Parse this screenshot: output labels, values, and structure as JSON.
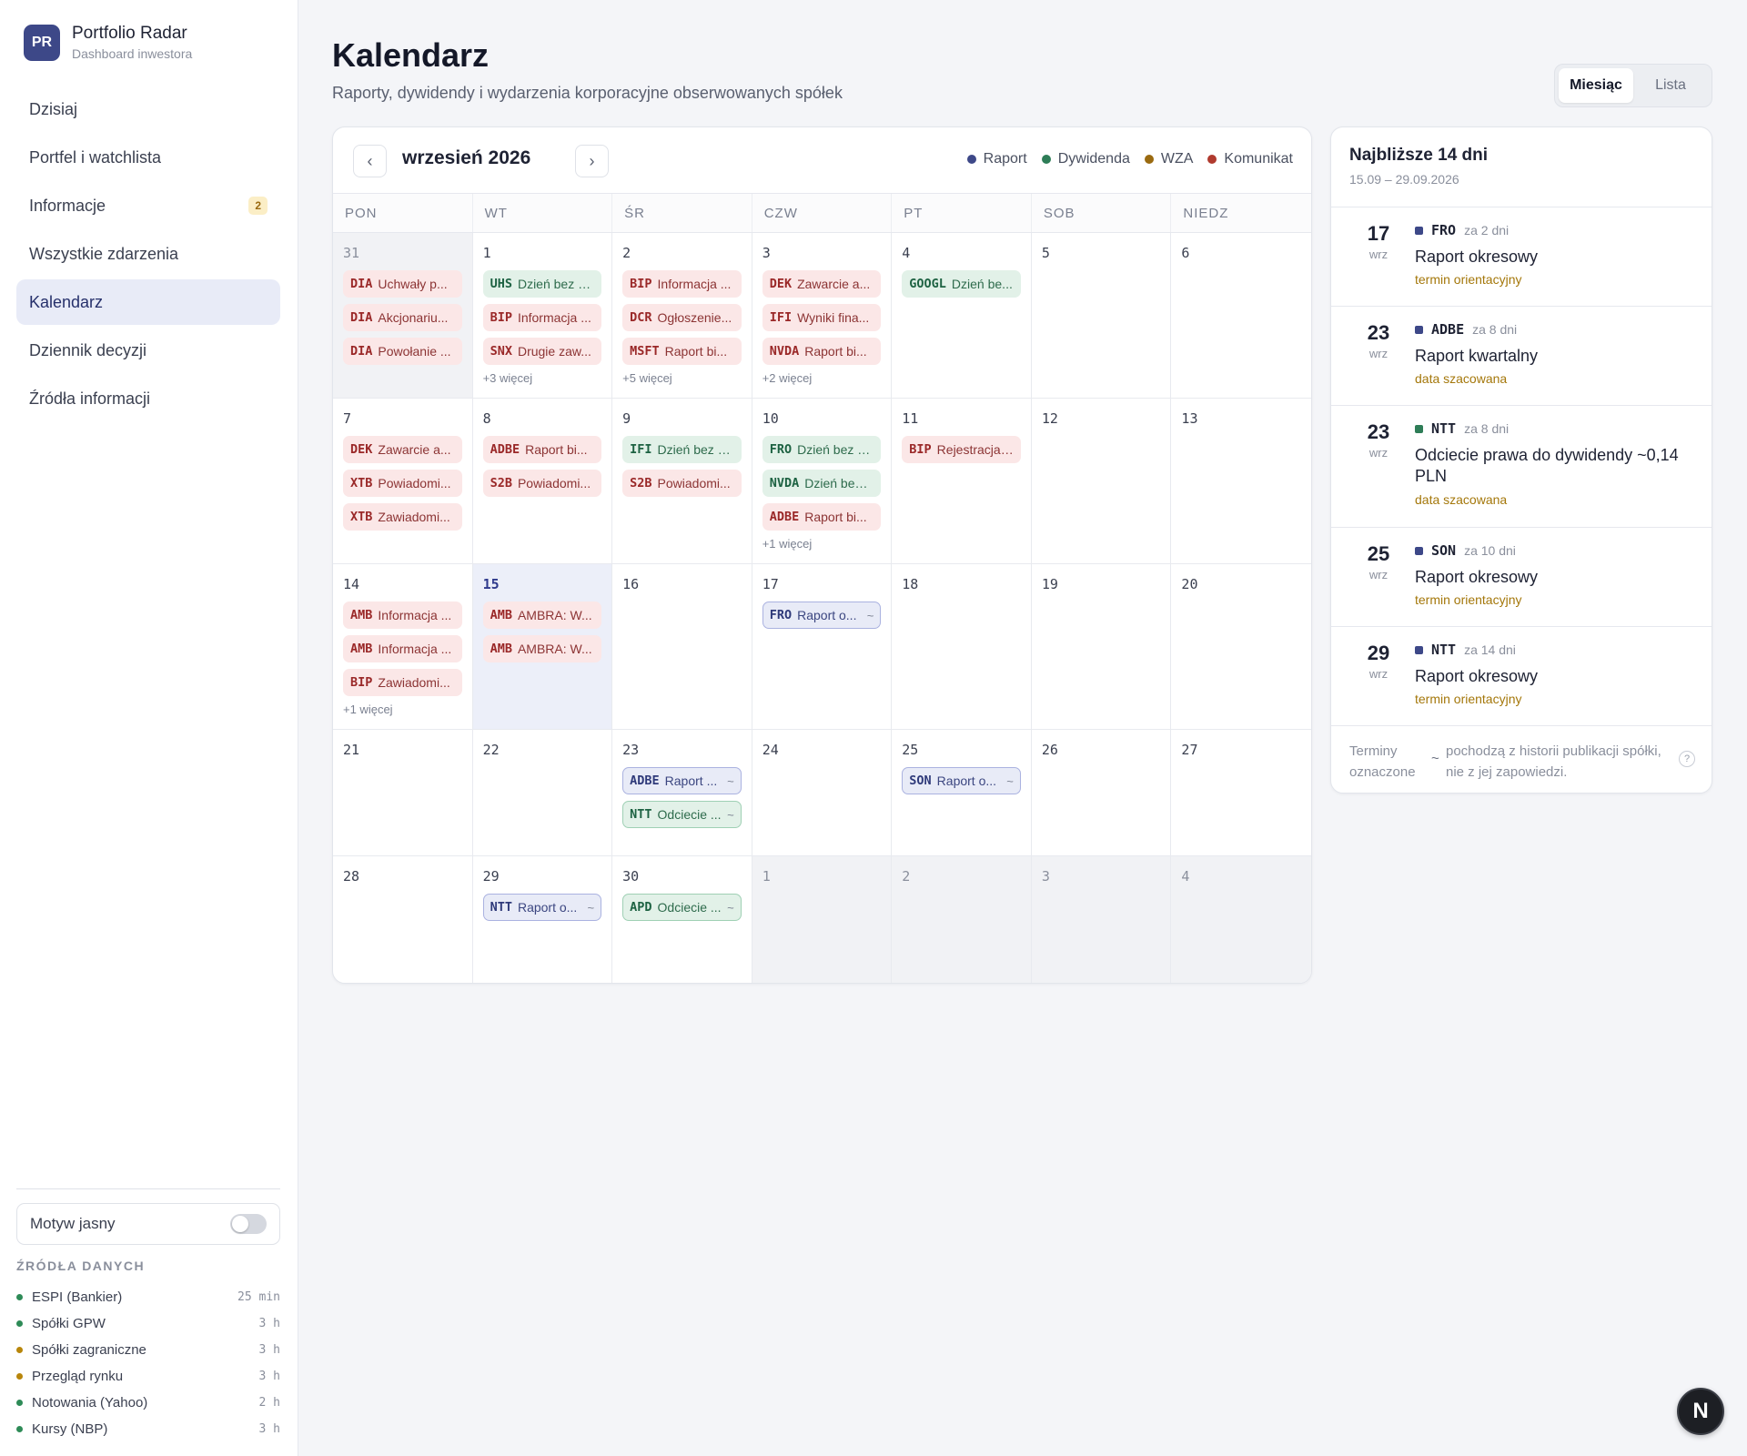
{
  "brand": {
    "logo": "PR",
    "name": "Portfolio Radar",
    "subtitle": "Dashboard inwestora"
  },
  "nav": [
    {
      "label": "Dzisiaj",
      "badge": ""
    },
    {
      "label": "Portfel i watchlista",
      "badge": ""
    },
    {
      "label": "Informacje",
      "badge": "2"
    },
    {
      "label": "Wszystkie zdarzenia",
      "badge": ""
    },
    {
      "label": "Kalendarz",
      "badge": "",
      "active": true
    },
    {
      "label": "Dziennik decyzji",
      "badge": ""
    },
    {
      "label": "Źródła informacji",
      "badge": ""
    }
  ],
  "theme_toggle": {
    "label": "Motyw jasny",
    "on": false
  },
  "sources": {
    "title": "ŹRÓDŁA DANYCH",
    "items": [
      {
        "name": "ESPI (Bankier)",
        "age": "25 min",
        "color": "#2e8b57"
      },
      {
        "name": "Spółki GPW",
        "age": "3 h",
        "color": "#2e8b57"
      },
      {
        "name": "Spółki zagraniczne",
        "age": "3 h",
        "color": "#b8860b"
      },
      {
        "name": "Przegląd rynku",
        "age": "3 h",
        "color": "#b8860b"
      },
      {
        "name": "Notowania (Yahoo)",
        "age": "2 h",
        "color": "#2e8b57"
      },
      {
        "name": "Kursy (NBP)",
        "age": "3 h",
        "color": "#2e8b57"
      }
    ]
  },
  "header": {
    "title": "Kalendarz",
    "subtitle": "Raporty, dywidendy i wydarzenia korporacyjne obserwowanych spółek"
  },
  "view_switch": {
    "month": "Miesiąc",
    "list": "Lista"
  },
  "calendar": {
    "prev": "‹",
    "next": "›",
    "month_label": "wrzesień 2026",
    "legend": [
      {
        "label": "Raport",
        "color": "#3d4888"
      },
      {
        "label": "Dywidenda",
        "color": "#2e7d57"
      },
      {
        "label": "WZA",
        "color": "#9a6a10"
      },
      {
        "label": "Komunikat",
        "color": "#b03a2e"
      }
    ],
    "weekdays": [
      "PON",
      "WT",
      "ŚR",
      "CZW",
      "PT",
      "SOB",
      "NIEDZ"
    ],
    "days": [
      {
        "num": "31",
        "other": true,
        "events": [
          {
            "ticker": "DIA",
            "title": "Uchwały p...",
            "type": "komunikat"
          },
          {
            "ticker": "DIA",
            "title": "Akcjonariu...",
            "type": "komunikat"
          },
          {
            "ticker": "DIA",
            "title": "Powołanie ...",
            "type": "komunikat"
          }
        ],
        "more": ""
      },
      {
        "num": "1",
        "events": [
          {
            "ticker": "UHS",
            "title": "Dzień bez d...",
            "type": "dywidenda"
          },
          {
            "ticker": "BIP",
            "title": "Informacja ...",
            "type": "komunikat"
          },
          {
            "ticker": "SNX",
            "title": "Drugie zaw...",
            "type": "komunikat"
          }
        ],
        "more": "+3 więcej"
      },
      {
        "num": "2",
        "events": [
          {
            "ticker": "BIP",
            "title": "Informacja ...",
            "type": "komunikat"
          },
          {
            "ticker": "DCR",
            "title": "Ogłoszenie...",
            "type": "komunikat"
          },
          {
            "ticker": "MSFT",
            "title": "Raport bi...",
            "type": "komunikat"
          }
        ],
        "more": "+5 więcej"
      },
      {
        "num": "3",
        "events": [
          {
            "ticker": "DEK",
            "title": "Zawarcie a...",
            "type": "komunikat"
          },
          {
            "ticker": "IFI",
            "title": "Wyniki fina...",
            "type": "komunikat"
          },
          {
            "ticker": "NVDA",
            "title": "Raport bi...",
            "type": "komunikat"
          }
        ],
        "more": "+2 więcej"
      },
      {
        "num": "4",
        "events": [
          {
            "ticker": "GOOGL",
            "title": "Dzień be...",
            "type": "dywidenda"
          }
        ],
        "more": ""
      },
      {
        "num": "5",
        "events": [],
        "more": ""
      },
      {
        "num": "6",
        "events": [],
        "more": ""
      },
      {
        "num": "7",
        "events": [
          {
            "ticker": "DEK",
            "title": "Zawarcie a...",
            "type": "komunikat"
          },
          {
            "ticker": "XTB",
            "title": "Powiadomi...",
            "type": "komunikat"
          },
          {
            "ticker": "XTB",
            "title": "Zawiadomi...",
            "type": "komunikat"
          }
        ],
        "more": ""
      },
      {
        "num": "8",
        "events": [
          {
            "ticker": "ADBE",
            "title": "Raport bi...",
            "type": "komunikat"
          },
          {
            "ticker": "S2B",
            "title": "Powiadomi...",
            "type": "komunikat"
          }
        ],
        "more": ""
      },
      {
        "num": "9",
        "events": [
          {
            "ticker": "IFI",
            "title": "Dzień bez d...",
            "type": "dywidenda"
          },
          {
            "ticker": "S2B",
            "title": "Powiadomi...",
            "type": "komunikat"
          }
        ],
        "more": ""
      },
      {
        "num": "10",
        "events": [
          {
            "ticker": "FRO",
            "title": "Dzień bez d...",
            "type": "dywidenda"
          },
          {
            "ticker": "NVDA",
            "title": "Dzień bez ...",
            "type": "dywidenda"
          },
          {
            "ticker": "ADBE",
            "title": "Raport bi...",
            "type": "komunikat"
          }
        ],
        "more": "+1 więcej"
      },
      {
        "num": "11",
        "events": [
          {
            "ticker": "BIP",
            "title": "Rejestracja ...",
            "type": "komunikat"
          }
        ],
        "more": ""
      },
      {
        "num": "12",
        "events": [],
        "more": ""
      },
      {
        "num": "13",
        "events": [],
        "more": ""
      },
      {
        "num": "14",
        "events": [
          {
            "ticker": "AMB",
            "title": "Informacja ...",
            "type": "komunikat"
          },
          {
            "ticker": "AMB",
            "title": "Informacja ...",
            "type": "komunikat"
          },
          {
            "ticker": "BIP",
            "title": "Zawiadomi...",
            "type": "komunikat"
          }
        ],
        "more": "+1 więcej"
      },
      {
        "num": "15",
        "today": true,
        "events": [
          {
            "ticker": "AMB",
            "title": "AMBRA: W...",
            "type": "komunikat"
          },
          {
            "ticker": "AMB",
            "title": "AMBRA: W...",
            "type": "komunikat"
          }
        ],
        "more": ""
      },
      {
        "num": "16",
        "events": [],
        "more": ""
      },
      {
        "num": "17",
        "events": [
          {
            "ticker": "FRO",
            "title": "Raport o...",
            "type": "raport",
            "tilde": "~"
          }
        ],
        "more": ""
      },
      {
        "num": "18",
        "events": [],
        "more": ""
      },
      {
        "num": "19",
        "events": [],
        "more": ""
      },
      {
        "num": "20",
        "events": [],
        "more": ""
      },
      {
        "num": "21",
        "events": [],
        "more": ""
      },
      {
        "num": "22",
        "events": [],
        "more": ""
      },
      {
        "num": "23",
        "events": [
          {
            "ticker": "ADBE",
            "title": "Raport ...",
            "type": "raport",
            "tilde": "~"
          },
          {
            "ticker": "NTT",
            "title": "Odciecie ...",
            "type": "dywidenda est",
            "tilde": "~"
          }
        ],
        "more": ""
      },
      {
        "num": "24",
        "events": [],
        "more": ""
      },
      {
        "num": "25",
        "events": [
          {
            "ticker": "SON",
            "title": "Raport o...",
            "type": "raport",
            "tilde": "~"
          }
        ],
        "more": ""
      },
      {
        "num": "26",
        "events": [],
        "more": ""
      },
      {
        "num": "27",
        "events": [],
        "more": ""
      },
      {
        "num": "28",
        "events": [],
        "more": ""
      },
      {
        "num": "29",
        "events": [
          {
            "ticker": "NTT",
            "title": "Raport o...",
            "type": "raport",
            "tilde": "~"
          }
        ],
        "more": ""
      },
      {
        "num": "30",
        "events": [
          {
            "ticker": "APD",
            "title": "Odciecie ...",
            "type": "dywidenda est",
            "tilde": "~"
          }
        ],
        "more": ""
      },
      {
        "num": "1",
        "other": true,
        "events": [],
        "more": ""
      },
      {
        "num": "2",
        "other": true,
        "events": [],
        "more": ""
      },
      {
        "num": "3",
        "other": true,
        "events": [],
        "more": ""
      },
      {
        "num": "4",
        "other": true,
        "events": [],
        "more": ""
      }
    ]
  },
  "upcoming": {
    "title": "Najbliższe 14 dni",
    "range": "15.09 – 29.09.2026",
    "items": [
      {
        "day": "17",
        "month": "wrz",
        "ticker": "FRO",
        "rel": "za 2 dni",
        "name": "Raport okresowy",
        "note": "termin orientacyjny",
        "color": "#3d4888"
      },
      {
        "day": "23",
        "month": "wrz",
        "ticker": "ADBE",
        "rel": "za 8 dni",
        "name": "Raport kwartalny",
        "note": "data szacowana",
        "color": "#3d4888"
      },
      {
        "day": "23",
        "month": "wrz",
        "ticker": "NTT",
        "rel": "za 8 dni",
        "name": "Odciecie prawa do dywidendy ~0,14 PLN",
        "note": "data szacowana",
        "color": "#2e7d57"
      },
      {
        "day": "25",
        "month": "wrz",
        "ticker": "SON",
        "rel": "za 10 dni",
        "name": "Raport okresowy",
        "note": "termin orientacyjny",
        "color": "#3d4888"
      },
      {
        "day": "29",
        "month": "wrz",
        "ticker": "NTT",
        "rel": "za 14 dni",
        "name": "Raport okresowy",
        "note": "termin orientacyjny",
        "color": "#3d4888"
      }
    ],
    "footer": {
      "a": "Terminy oznaczone",
      "tilde": "~",
      "b": "pochodzą z historii publikacji spółki, nie z jej zapowiedzi.",
      "help": "?"
    }
  },
  "fab": "N"
}
